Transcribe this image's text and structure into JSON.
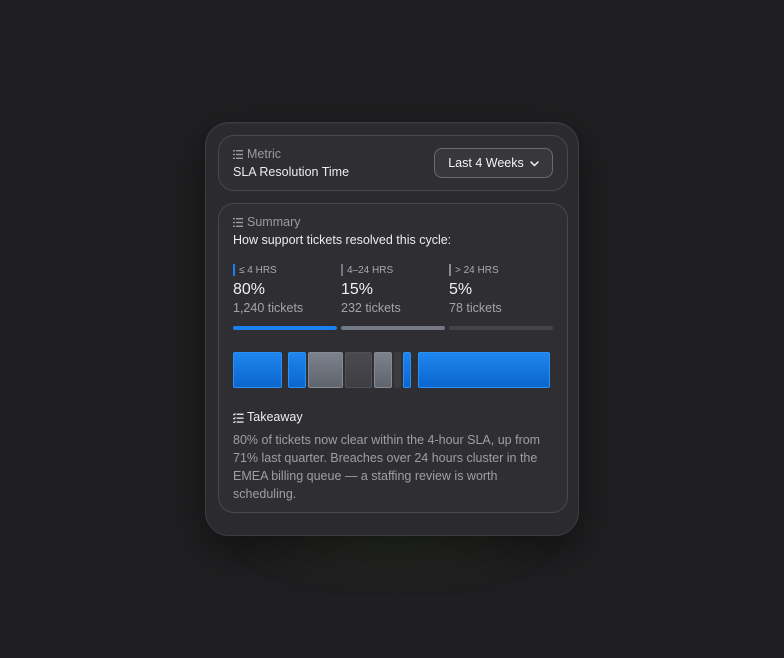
{
  "metric": {
    "label": "Metric",
    "value": "SLA Resolution Time",
    "range_button": "Last 4 Weeks"
  },
  "summary": {
    "label": "Summary",
    "heading": "How support tickets resolved this cycle:",
    "stats": [
      {
        "tag": "≤ 4 HRS",
        "pct": "80%",
        "count": "1,240 tickets",
        "color": "#1a7ff0"
      },
      {
        "tag": "4–24 HRS",
        "pct": "15%",
        "count": "232 tickets",
        "color": "#737882"
      },
      {
        "tag": "> 24 HRS",
        "pct": "5%",
        "count": "78 tickets",
        "color": "#4a4a50"
      }
    ]
  },
  "takeaway": {
    "label": "Takeaway",
    "text": "80% of tickets now clear within the 4-hour SLA, up from 71% last quarter. Breaches over 24 hours cluster in the EMEA billing queue — a staffing review is worth scheduling."
  },
  "colors": {
    "accent": "#1a7ff0",
    "mid": "#737882",
    "low": "#4a4a50",
    "background": "#1f1f21",
    "card": "#2b2b2e"
  },
  "icons": {
    "metric": "list-icon",
    "summary": "list-icon",
    "takeaway": "checklist-icon",
    "range": "chevron-down-icon"
  }
}
